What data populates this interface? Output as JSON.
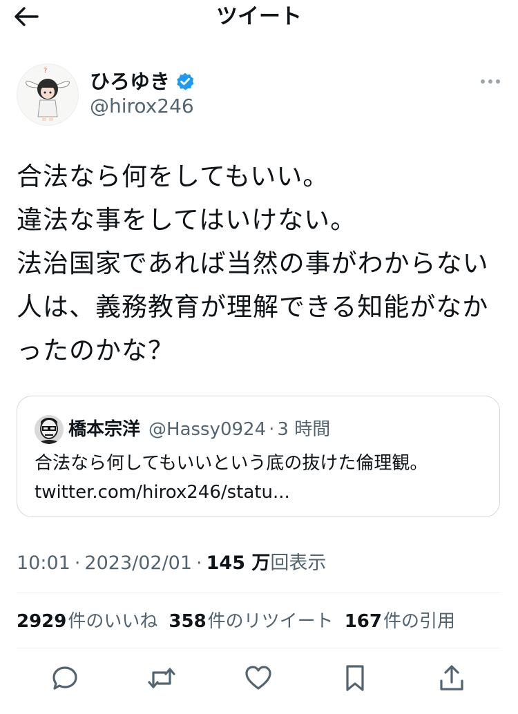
{
  "header": {
    "back_icon": "arrow-left-icon",
    "title": "ツイート"
  },
  "author": {
    "display_name": "ひろゆき",
    "handle": "@hirox246",
    "verified": true,
    "verified_color": "#1d9bf0"
  },
  "tweet": {
    "text": "合法なら何をしてもいい。\n違法な事をしてはいけない。\n法治国家であれば当然の事がわからない人は、義務教育が理解できる知能がなかったのかな？"
  },
  "quote": {
    "name": "橋本宗洋",
    "handle": "@Hassy0924",
    "separator": "·",
    "time": "3 時間",
    "text": "合法なら何してもいいという底の抜けた倫理観。\ntwitter.com/hirox246/statu..."
  },
  "meta": {
    "time": "10:01",
    "sep1": "·",
    "date": "2023/02/01",
    "sep2": "·",
    "views_count": "145 万",
    "views_label": "回表示"
  },
  "stats": {
    "likes_count": "2929",
    "likes_label": "件のいいね",
    "retweets_count": "358",
    "retweets_label": "件のリツイート",
    "quotes_count": "167",
    "quotes_label": "件の引用"
  },
  "actions": {
    "icons": [
      "reply-icon",
      "retweet-icon",
      "like-icon",
      "bookmark-icon",
      "share-icon"
    ]
  },
  "colors": {
    "text_primary": "#0f1419",
    "text_secondary": "#536471",
    "border": "#cfd9de",
    "accent": "#1d9bf0"
  }
}
